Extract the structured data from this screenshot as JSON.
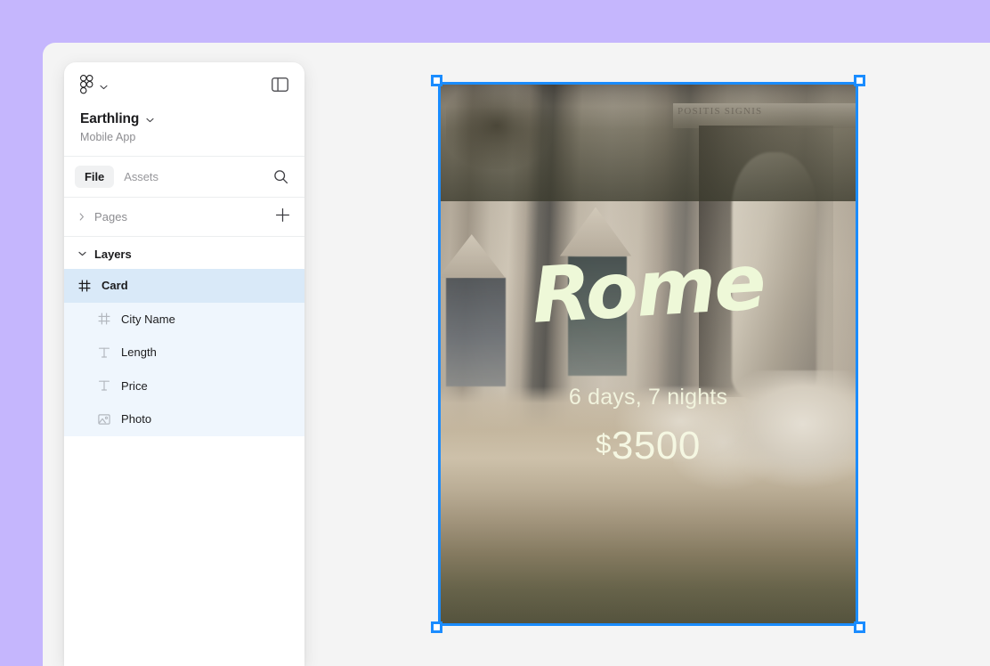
{
  "theme": {
    "page_background": "#c5b6fd",
    "app_background": "#f4f4f4",
    "panel_background": "#ffffff",
    "selection_blue": "#1a8cff",
    "layer_selected_bg": "#d9e9f8",
    "layer_child_bg": "#eff6fd",
    "text_primary": "#1c1c1e",
    "text_muted": "#8c8c90",
    "card_text_color": "#eef8d8"
  },
  "sidebar": {
    "logo_icon": "figma-logo-icon",
    "logo_chevron_icon": "chevron-down-icon",
    "panel_toggle_icon": "sidebar-panel-toggle-icon",
    "file_title": "Earthling",
    "file_title_chevron_icon": "chevron-down-icon",
    "file_subtitle": "Mobile App",
    "tabs": [
      {
        "label": "File",
        "active": true
      },
      {
        "label": "Assets",
        "active": false
      }
    ],
    "search_icon": "search-icon",
    "pages": {
      "label": "Pages",
      "caret_icon": "chevron-right-icon",
      "expanded": false,
      "add_icon": "plus-icon"
    },
    "layers": {
      "label": "Layers",
      "caret_icon": "chevron-down-icon",
      "expanded": true,
      "items": [
        {
          "label": "Card",
          "icon": "frame-icon",
          "selected": true,
          "child": false
        },
        {
          "label": "City Name",
          "icon": "frame-icon",
          "selected": false,
          "child": true
        },
        {
          "label": "Length",
          "icon": "text-icon",
          "selected": false,
          "child": true
        },
        {
          "label": "Price",
          "icon": "text-icon",
          "selected": false,
          "child": true
        },
        {
          "label": "Photo",
          "icon": "image-icon",
          "selected": false,
          "child": true
        }
      ]
    }
  },
  "canvas": {
    "selected_frame": {
      "name": "Card",
      "handles": [
        "top-left",
        "top-right",
        "bottom-left",
        "bottom-right"
      ]
    },
    "card": {
      "photo_alt": "Trevi Fountain facade with statues",
      "inscription": "POSITIS SIGNIS",
      "city_name": "Rome",
      "trip_length": "6 days, 7 nights",
      "price_currency": "$",
      "price_amount": "3500"
    }
  }
}
